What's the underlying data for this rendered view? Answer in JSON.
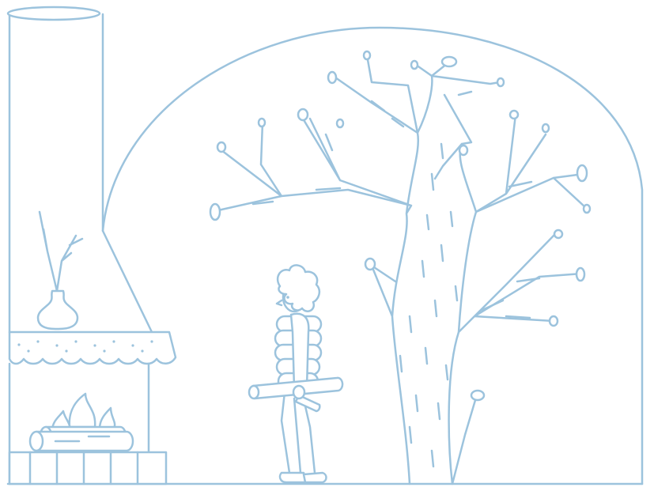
{
  "illustration": {
    "style": "single-color line drawing",
    "line_color": "#9cc3dd",
    "background_color": "#ffffff"
  }
}
